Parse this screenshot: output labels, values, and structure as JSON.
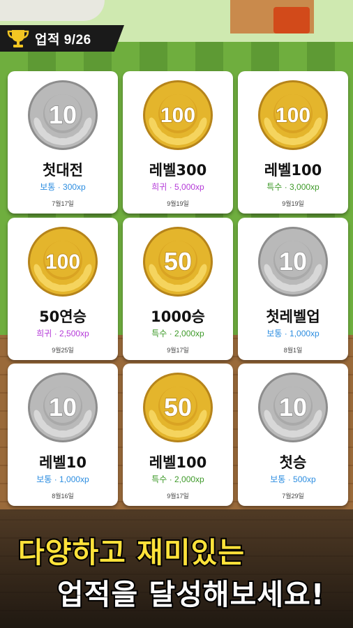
{
  "header": {
    "trophy_icon": "trophy-icon",
    "title": "업적 9/26"
  },
  "colors": {
    "normal": "#2c8de0",
    "rare": "#b43ad8",
    "special": "#3f9a2a",
    "gold": "#e4b52c",
    "silver": "#bdbdbd"
  },
  "achievements": [
    {
      "medal": "silver",
      "number": "10",
      "name": "첫대전",
      "rank": "보통",
      "xp": "300xp",
      "date": "7월17일"
    },
    {
      "medal": "gold",
      "number": "100",
      "name": "레벨300",
      "rank": "희귀",
      "xp": "5,000xp",
      "date": "9월19일"
    },
    {
      "medal": "gold",
      "number": "100",
      "name": "레벨100",
      "rank": "특수",
      "xp": "3,000xp",
      "date": "9월19일"
    },
    {
      "medal": "gold",
      "number": "100",
      "name": "50연승",
      "rank": "희귀",
      "xp": "2,500xp",
      "date": "9월25일"
    },
    {
      "medal": "gold",
      "number": "50",
      "name": "1000승",
      "rank": "특수",
      "xp": "2,000xp",
      "date": "9월17일"
    },
    {
      "medal": "silver",
      "number": "10",
      "name": "첫레벨업",
      "rank": "보통",
      "xp": "1,000xp",
      "date": "8월1일"
    },
    {
      "medal": "silver",
      "number": "10",
      "name": "레벨10",
      "rank": "보통",
      "xp": "1,000xp",
      "date": "8월16일"
    },
    {
      "medal": "gold",
      "number": "50",
      "name": "레벨100",
      "rank": "특수",
      "xp": "2,000xp",
      "date": "9월17일"
    },
    {
      "medal": "silver",
      "number": "10",
      "name": "첫승",
      "rank": "보통",
      "xp": "500xp",
      "date": "7월29일"
    }
  ],
  "slogan": {
    "line1": "다양하고 재미있는",
    "line2": "업적을 달성해보세요!"
  }
}
